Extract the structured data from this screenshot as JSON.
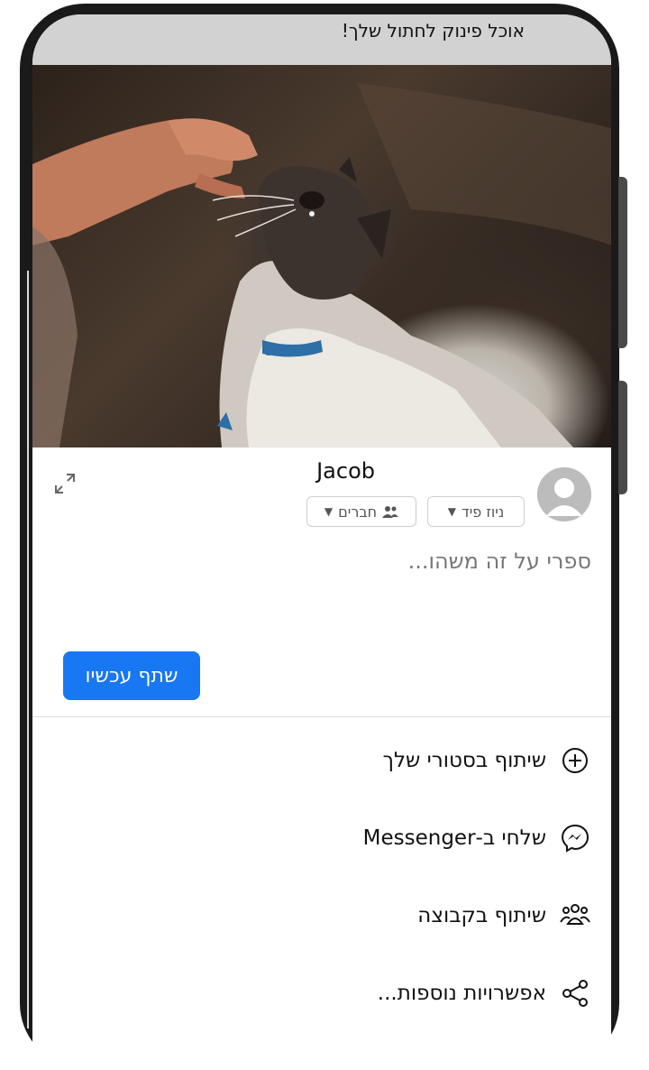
{
  "post": {
    "caption": "אוכל פינוק לחתול שלך!"
  },
  "share_sheet": {
    "username": "Jacob",
    "feed_chip": "ניוז פיד",
    "audience_chip": "חברים",
    "composer_placeholder": "ספרי על זה משהו...",
    "share_now_label": "שתף עכשיו",
    "options": [
      {
        "label": "שיתוף בסטורי שלך",
        "icon": "plus-circle-icon"
      },
      {
        "label": "שלחי ב-Messenger",
        "icon": "messenger-icon"
      },
      {
        "label": "שיתוף בקבוצה",
        "icon": "group-icon"
      },
      {
        "label": "אפשרויות נוספות...",
        "icon": "share-icon"
      }
    ],
    "accent_color": "#1877f2"
  }
}
